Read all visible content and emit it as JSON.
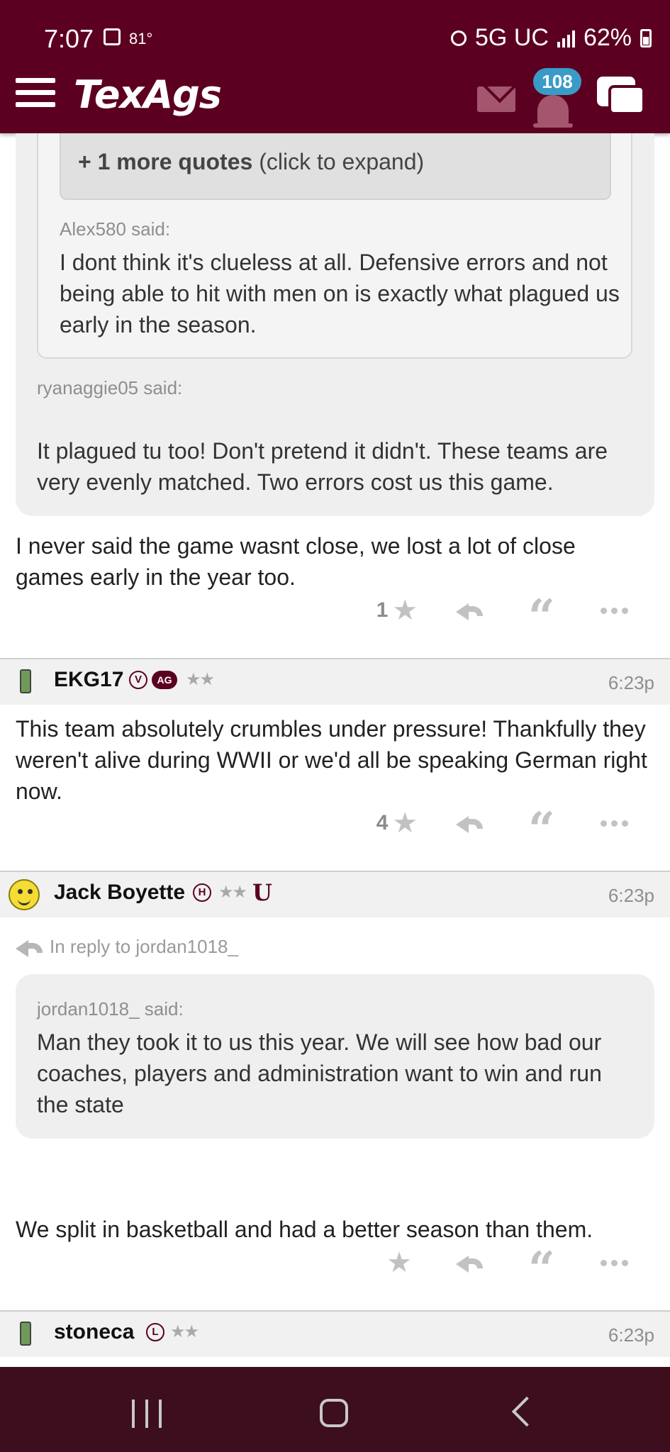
{
  "status_bar": {
    "time": "7:07",
    "temperature": "81°",
    "network": "5G UC",
    "battery": "62%"
  },
  "nav": {
    "logo": "TexAgs",
    "notifications_count": "108",
    "brand_color": "#5c0022",
    "badge_color": "#3a9bc7"
  },
  "post1": {
    "more_quotes_bold": "+ 1 more quotes",
    "more_quotes_hint": "(click to expand)",
    "inner_quote_author": "Alex580 said:",
    "inner_quote_text": "I dont think it's clueless at all. Defensive errors and not being able to hit with men on is exactly what plagued us early in the season.",
    "outer_quote_author": "ryanaggie05 said:",
    "outer_quote_text": "It plagued tu too! Don't pretend it didn't. These teams are very evenly matched. Two errors cost us this game.",
    "body": "I never said the game wasnt close, we lost a lot of close games early in the year too.",
    "likes": "1"
  },
  "post2": {
    "username": "EKG17",
    "badge_v": "V",
    "badge_ag": "AG",
    "stars": "★★",
    "time": "6:23p",
    "body": "This team absolutely crumbles under pressure! Thankfully they weren't alive during WWII or we'd all be speaking German right now.",
    "likes": "4"
  },
  "post3": {
    "username": "Jack Boyette",
    "badge_h": "H",
    "stars": "★★",
    "u_logo": "U",
    "time": "6:23p",
    "in_reply_to": "In reply to jordan1018_",
    "quote_author": "jordan1018_ said:",
    "quote_text": "Man they took it to us this year. We will see how bad our coaches, players and administration want to win and run the state",
    "body": "We split in basketball and had a better season than them.",
    "likes": ""
  },
  "post4": {
    "username": "stoneca",
    "badge_l": "L",
    "stars": "★★",
    "time": "6:23p"
  },
  "icons": {
    "star": "★",
    "quote": "“"
  }
}
